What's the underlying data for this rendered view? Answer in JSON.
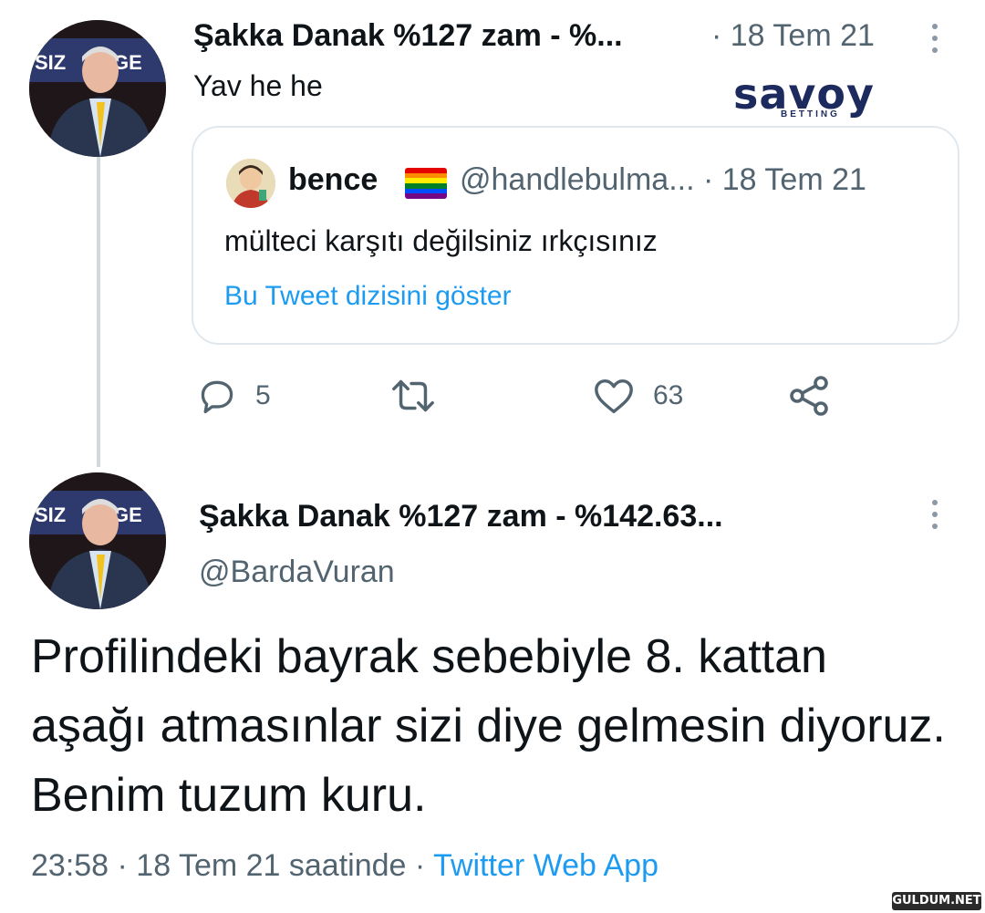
{
  "tweet1": {
    "display_name": "Şakka Danak %127 zam - %...",
    "meta": "· 18 Tem 21",
    "text": "Yav he he",
    "avatar_text": "SIZ        GE",
    "quote": {
      "display_name": "bence",
      "handle_meta": "@handlebulma...  · 18 Tem 21",
      "text": "mülteci karşıtı değilsiniz ırkçısınız",
      "show_thread_link": "Bu Tweet dizisini göster",
      "flag_colors": [
        "#e40303",
        "#ff8c00",
        "#ffed00",
        "#008026",
        "#004dff",
        "#750787"
      ]
    },
    "actions": {
      "reply_count": "5",
      "retweet_count": "",
      "like_count": "63"
    }
  },
  "watermark": {
    "brand": "savoy",
    "sub": "BETTING"
  },
  "tweet2": {
    "display_name": "Şakka Danak %127 zam - %142.63...",
    "handle": "@BardaVuran",
    "avatar_text": "SIZ        GE",
    "text": "Profilindeki bayrak sebebiyle 8. kattan aşağı atmasınlar sizi diye gelmesin diyoruz. Benim tuzum kuru.",
    "time_date": "23:58 · 18 Tem 21 saatinde · ",
    "source_app": "Twitter Web App"
  },
  "site_mark": "GULDUM.NET",
  "colors": {
    "link_blue": "#1d9bf0",
    "meta_gray": "#536471",
    "border": "#e1e8ed"
  }
}
